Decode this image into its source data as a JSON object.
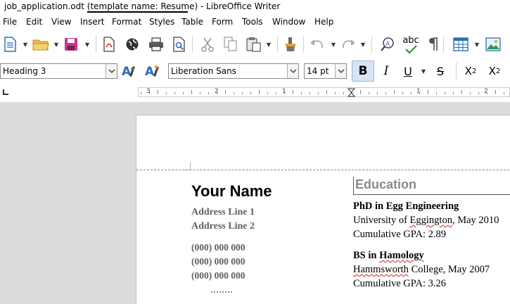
{
  "window": {
    "title_prefix": "job_application.odt ",
    "title_highlight": "(template name: Resume)",
    "title_suffix": " - LibreOffice Writer"
  },
  "menu": [
    "File",
    "Edit",
    "View",
    "Insert",
    "Format",
    "Styles",
    "Table",
    "Form",
    "Tools",
    "Window",
    "Help"
  ],
  "toolbar": {
    "paragraph_style": "Heading 3",
    "font_name": "Liberation Sans",
    "font_size": "14 pt",
    "bold_label": "B",
    "italic_label": "I",
    "underline_label": "U",
    "strike_label": "S",
    "superscript_label": "X",
    "superscript_mark": "2",
    "subscript_label": "X",
    "subscript_mark": "2",
    "spelling_label": "abc"
  },
  "ruler": {
    "labels": [
      "3",
      "2",
      "1",
      "1",
      "2"
    ]
  },
  "document": {
    "name": "Your Name",
    "address_line_1": "Address Line 1",
    "address_line_2": "Address Line 2",
    "phones": [
      "(000) 000 000",
      "(000) 000 000",
      "(000) 000 000"
    ],
    "education_heading": "Education",
    "degree_1": "PhD in Egg Engineering",
    "school_1_prefix": "University of ",
    "school_1_name": "Eggington",
    "school_1_suffix": ", May 2010",
    "gpa_1": "Cumulative GPA: 2.89",
    "degree_2_prefix": "BS in ",
    "degree_2_name": "Hamology",
    "school_2_name": "Hammsworth",
    "school_2_suffix": " College, May 2007",
    "gpa_2": "Cumulative GPA: 3.26"
  },
  "colors": {
    "bold_active_bg": "#d6e4f3",
    "heading_gray": "#8a8a8a",
    "address_gray": "#606060",
    "header_dashed_line": "#5a8fc7",
    "spellcheck_red": "#d02020"
  }
}
